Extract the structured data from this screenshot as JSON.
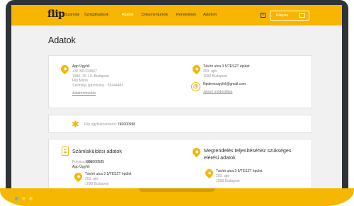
{
  "nav": {
    "logo": "flip",
    "links": [
      "Számlák",
      "Szolgáltatások",
      "Adatok",
      "Dokumentumok",
      "Rendelések",
      "Ajánlom"
    ],
    "active": "Adatok",
    "facebook_glyph": "f",
    "login_label": "Kilépés"
  },
  "page": {
    "title": "Adatok"
  },
  "customer": {
    "name": "App Ügyfél",
    "phone": "+36 301234567",
    "dob": "1980. 10. 10. Budapest",
    "mother": "Flip Mária",
    "id_doc": "Személyi igazolvány - 53444484",
    "edit_link": "Adatmódosítás"
  },
  "address": {
    "street": "Távíró utca 3 5/TESZT épület",
    "floor": "203. ajtó",
    "city": "1098 Budapest"
  },
  "email": {
    "value": "flipdemougyfel@gmail.com",
    "change_link": "Jelszó módosítása"
  },
  "customer_id": {
    "label": "Flip ügyfélazonosító:",
    "value": "740000998"
  },
  "billing": {
    "heading": "Számlaküldési adatok",
    "account_label": "Folyószámla:",
    "account_value": "900000585",
    "name": "App Ügyfél",
    "street": "Távíró utca 3 5/TESZT épület",
    "floor": "203. ajtó",
    "city": "1098 Budapest"
  },
  "delivery": {
    "heading_line1": "Megrendelés teljesítéséhez szükséges",
    "heading_line2": "elérési adatok",
    "street": "Távíró utca 3 5/TESZT épület",
    "floor": "203. ajtó",
    "city": "1098 Budapest"
  },
  "colors": {
    "accent": "#f7b500",
    "frame": "#2f3337",
    "dots": [
      "#5ab4f0",
      "#f5b700",
      "#f5b700"
    ]
  },
  "icons": [
    "pin-icon",
    "at-icon",
    "gear-icon",
    "document-icon",
    "logout-icon",
    "facebook-icon"
  ]
}
